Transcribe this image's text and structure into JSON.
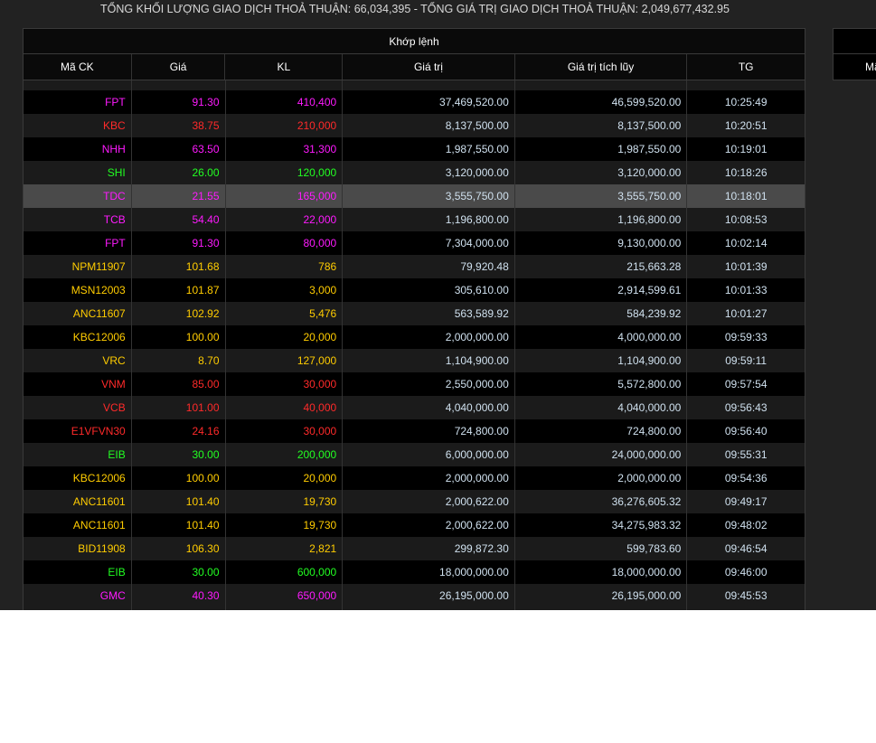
{
  "summary": "TỔNG KHỐI LƯỢNG GIAO DỊCH THOẢ THUẬN: 66,034,395  -  TỔNG GIÁ TRỊ GIAO DỊCH THOẢ THUẬN: 2,049,677,432.95",
  "table": {
    "title": "Khớp lệnh",
    "headers": [
      "Mã CK",
      "Giá",
      "KL",
      "Giá trị",
      "Giá trị tích lũy",
      "TG"
    ]
  },
  "right_panel": {
    "header": "Mã"
  },
  "colors": {
    "red": "#ff2a2a",
    "magenta": "#ff1aff",
    "yellow": "#ffcc00",
    "green": "#22ff22"
  },
  "rows": [
    {
      "code": "FPT",
      "price": "91.30",
      "vol": "410,400",
      "value": "37,469,520.00",
      "cum": "46,599,520.00",
      "time": "10:25:49",
      "color": "magenta"
    },
    {
      "code": "KBC",
      "price": "38.75",
      "vol": "210,000",
      "value": "8,137,500.00",
      "cum": "8,137,500.00",
      "time": "10:20:51",
      "color": "red"
    },
    {
      "code": "NHH",
      "price": "63.50",
      "vol": "31,300",
      "value": "1,987,550.00",
      "cum": "1,987,550.00",
      "time": "10:19:01",
      "color": "magenta"
    },
    {
      "code": "SHI",
      "price": "26.00",
      "vol": "120,000",
      "value": "3,120,000.00",
      "cum": "3,120,000.00",
      "time": "10:18:26",
      "color": "green"
    },
    {
      "code": "TDC",
      "price": "21.55",
      "vol": "165,000",
      "value": "3,555,750.00",
      "cum": "3,555,750.00",
      "time": "10:18:01",
      "color": "magenta",
      "highlight": true
    },
    {
      "code": "TCB",
      "price": "54.40",
      "vol": "22,000",
      "value": "1,196,800.00",
      "cum": "1,196,800.00",
      "time": "10:08:53",
      "color": "magenta"
    },
    {
      "code": "FPT",
      "price": "91.30",
      "vol": "80,000",
      "value": "7,304,000.00",
      "cum": "9,130,000.00",
      "time": "10:02:14",
      "color": "magenta"
    },
    {
      "code": "NPM11907",
      "price": "101.68",
      "vol": "786",
      "value": "79,920.48",
      "cum": "215,663.28",
      "time": "10:01:39",
      "color": "yellow"
    },
    {
      "code": "MSN12003",
      "price": "101.87",
      "vol": "3,000",
      "value": "305,610.00",
      "cum": "2,914,599.61",
      "time": "10:01:33",
      "color": "yellow"
    },
    {
      "code": "ANC11607",
      "price": "102.92",
      "vol": "5,476",
      "value": "563,589.92",
      "cum": "584,239.92",
      "time": "10:01:27",
      "color": "yellow"
    },
    {
      "code": "KBC12006",
      "price": "100.00",
      "vol": "20,000",
      "value": "2,000,000.00",
      "cum": "4,000,000.00",
      "time": "09:59:33",
      "color": "yellow"
    },
    {
      "code": "VRC",
      "price": "8.70",
      "vol": "127,000",
      "value": "1,104,900.00",
      "cum": "1,104,900.00",
      "time": "09:59:11",
      "color": "yellow"
    },
    {
      "code": "VNM",
      "price": "85.00",
      "vol": "30,000",
      "value": "2,550,000.00",
      "cum": "5,572,800.00",
      "time": "09:57:54",
      "color": "red"
    },
    {
      "code": "VCB",
      "price": "101.00",
      "vol": "40,000",
      "value": "4,040,000.00",
      "cum": "4,040,000.00",
      "time": "09:56:43",
      "color": "red"
    },
    {
      "code": "E1VFVN30",
      "price": "24.16",
      "vol": "30,000",
      "value": "724,800.00",
      "cum": "724,800.00",
      "time": "09:56:40",
      "color": "red"
    },
    {
      "code": "EIB",
      "price": "30.00",
      "vol": "200,000",
      "value": "6,000,000.00",
      "cum": "24,000,000.00",
      "time": "09:55:31",
      "color": "green"
    },
    {
      "code": "KBC12006",
      "price": "100.00",
      "vol": "20,000",
      "value": "2,000,000.00",
      "cum": "2,000,000.00",
      "time": "09:54:36",
      "color": "yellow"
    },
    {
      "code": "ANC11601",
      "price": "101.40",
      "vol": "19,730",
      "value": "2,000,622.00",
      "cum": "36,276,605.32",
      "time": "09:49:17",
      "color": "yellow"
    },
    {
      "code": "ANC11601",
      "price": "101.40",
      "vol": "19,730",
      "value": "2,000,622.00",
      "cum": "34,275,983.32",
      "time": "09:48:02",
      "color": "yellow"
    },
    {
      "code": "BID11908",
      "price": "106.30",
      "vol": "2,821",
      "value": "299,872.30",
      "cum": "599,783.60",
      "time": "09:46:54",
      "color": "yellow"
    },
    {
      "code": "EIB",
      "price": "30.00",
      "vol": "600,000",
      "value": "18,000,000.00",
      "cum": "18,000,000.00",
      "time": "09:46:00",
      "color": "green"
    },
    {
      "code": "GMC",
      "price": "40.30",
      "vol": "650,000",
      "value": "26,195,000.00",
      "cum": "26,195,000.00",
      "time": "09:45:53",
      "color": "magenta"
    }
  ]
}
